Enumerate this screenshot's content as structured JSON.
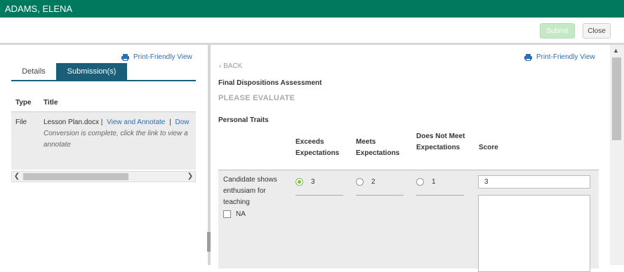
{
  "header": {
    "student_name": "ADAMS, ELENA"
  },
  "actions": {
    "submit_label": "Submit",
    "close_label": "Close"
  },
  "left_pane": {
    "print_link": "Print-Friendly View",
    "tabs": [
      {
        "label": "Details",
        "active": false
      },
      {
        "label": "Submission(s)",
        "active": true
      }
    ],
    "columns": {
      "type": "Type",
      "title": "Title"
    },
    "rows": [
      {
        "type": "File",
        "file_name": "Lesson Plan.docx",
        "sep1": "|",
        "view_link": "View and Annotate",
        "sep2": "|",
        "download_link": "Dow",
        "note_line1": "Conversion is complete, click the link to view a",
        "note_line2": "annotate"
      }
    ]
  },
  "right_pane": {
    "print_link": "Print-Friendly View",
    "back": "BACK",
    "form_title": "Final Dispositions Assessment",
    "instruction": "PLEASE EVALUATE",
    "section": "Personal Traits",
    "columns": {
      "exceeds": "Exceeds Expectations",
      "meets": "Meets Expectations",
      "does_not_meet": "Does Not Meet Expectations",
      "score": "Score"
    },
    "criteria": [
      {
        "label": "Candidate shows enthusiam for teaching",
        "options": [
          "3",
          "2",
          "1"
        ],
        "selected": "3",
        "na_label": "NA",
        "na_checked": false,
        "score_value": "3"
      }
    ]
  },
  "colors": {
    "header_bg": "#007a5e",
    "tab_active_bg": "#1b5e78",
    "link": "#2a6ebb",
    "radio_selected": "#7cc242",
    "submit_disabled_bg": "#c5e8c5"
  }
}
